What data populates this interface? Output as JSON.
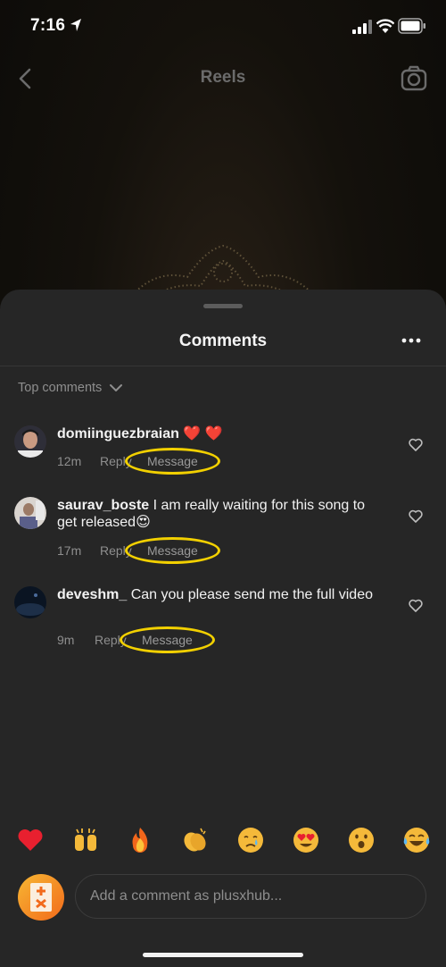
{
  "status_bar": {
    "time": "7:16"
  },
  "header": {
    "title": "Reels",
    "icons": [
      "back-icon",
      "camera-icon"
    ]
  },
  "sheet": {
    "title": "Comments",
    "sort_label": "Top comments"
  },
  "comments": [
    {
      "username": "domiinguezbraian",
      "text": " ❤️ ❤️",
      "time": "12m",
      "reply_label": "Reply",
      "message_label": "Message"
    },
    {
      "username": "saurav_boste",
      "text": " I am really waiting for this song to get released😍",
      "time": "17m",
      "reply_label": "Reply",
      "message_label": "Message"
    },
    {
      "username": "deveshm_",
      "text": " Can you please send me the full video",
      "time": "9m",
      "reply_label": "Reply",
      "message_label": "Message"
    }
  ],
  "reactions": [
    "❤️",
    "🙌",
    "🔥",
    "👏",
    "😢",
    "😍",
    "😮",
    "😂"
  ],
  "composer": {
    "placeholder": "Add a comment as plusxhub..."
  },
  "colors": {
    "sheet_bg": "#262626",
    "highlight_ring": "#f2d000",
    "muted_text": "#8e8e8e"
  }
}
